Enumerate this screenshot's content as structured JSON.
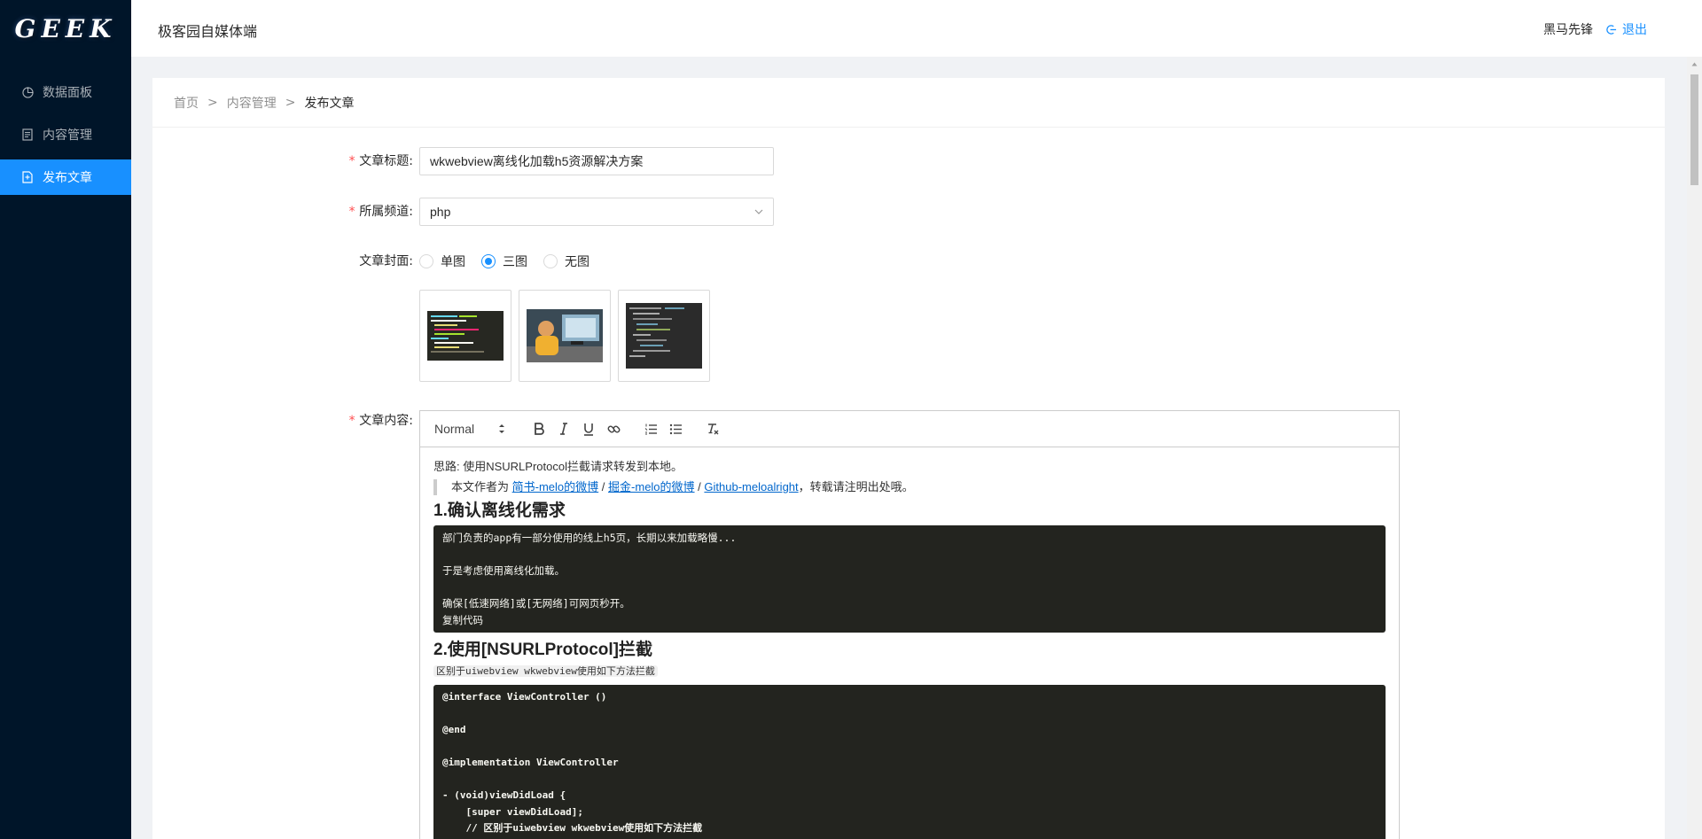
{
  "sidebar": {
    "logo": "GEEK",
    "items": [
      {
        "label": "数据面板",
        "icon": "pie-chart-icon",
        "active": false
      },
      {
        "label": "内容管理",
        "icon": "document-list-icon",
        "active": false
      },
      {
        "label": "发布文章",
        "icon": "file-edit-icon",
        "active": true
      }
    ]
  },
  "header": {
    "title": "极客园自媒体端",
    "username": "黑马先锋",
    "logout_label": "退出"
  },
  "breadcrumb": {
    "home": "首页",
    "content": "内容管理",
    "current": "发布文章",
    "separator": ">"
  },
  "form": {
    "title_label": "文章标题:",
    "title_value": "wkwebview离线化加载h5资源解决方案",
    "channel_label": "所属频道:",
    "channel_value": "php",
    "cover_label": "文章封面:",
    "cover_options": [
      "单图",
      "三图",
      "无图"
    ],
    "cover_selected": "三图",
    "content_label": "文章内容:"
  },
  "editor": {
    "toolbar": {
      "header_select": "Normal",
      "buttons": [
        "bold-icon",
        "italic-icon",
        "underline-icon",
        "link-icon",
        "ordered-list-icon",
        "bullet-list-icon",
        "clear-format-icon"
      ]
    },
    "intro": "思路: 使用NSURLProtocol拦截请求转发到本地。",
    "quote_prefix": "本文作者为",
    "quote_link1": "简书-melo的微博",
    "quote_slash1": "/",
    "quote_link2": "掘金-melo的微博",
    "quote_slash2": "/",
    "quote_link3": "Github-meloalright",
    "quote_suffix": "，转载请注明出处哦。",
    "h1": "1.确认离线化需求",
    "code1": "部门负责的app有一部分使用的线上h5页，长期以来加载略慢...\n\n于是考虑使用离线化加载。\n\n确保[低速网络]或[无网络]可网页秒开。\n复制代码",
    "h2": "2.使用[NSURLProtocol]拦截",
    "inline_note": "区别于uiwebview wkwebview使用如下方法拦截",
    "code2": "@interface ViewController ()\n\n@end\n\n@implementation ViewController\n\n- (void)viewDidLoad {\n    [super viewDidLoad];\n    // 区别于uiwebview wkwebview使用如下方法拦截"
  },
  "colors": {
    "sidebar_bg": "#001529",
    "primary": "#1890ff",
    "required": "#ff4d4f",
    "code_bg": "#23241f"
  }
}
